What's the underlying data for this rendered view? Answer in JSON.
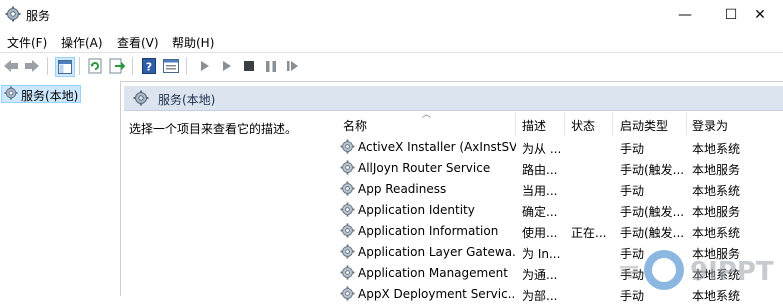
{
  "window": {
    "title": "服务",
    "minimize_glyph": "—",
    "maximize_glyph": "☐",
    "close_glyph": "✕"
  },
  "menu": [
    {
      "label": "文件(F)"
    },
    {
      "label": "操作(A)"
    },
    {
      "label": "查看(V)"
    },
    {
      "label": "帮助(H)"
    }
  ],
  "toolbar": {
    "icons": [
      "back-arrow-icon",
      "forward-arrow-icon",
      "show-hide-tree-icon",
      "refresh-icon",
      "export-list-icon",
      "help-icon",
      "properties-icon",
      "start-service-icon",
      "start-service-params-icon",
      "stop-service-icon",
      "pause-service-icon",
      "resume-service-icon"
    ]
  },
  "tree": {
    "item_label": "服务(本地)"
  },
  "panel": {
    "title": "服务(本地)",
    "description_prompt": "选择一个项目来查看它的描述。"
  },
  "columns": {
    "name": "名称",
    "desc": "描述",
    "status": "状态",
    "startup": "启动类型",
    "logon": "登录为"
  },
  "services": [
    {
      "name": "ActiveX Installer (AxInstSV)",
      "desc": "为从 ...",
      "status": "",
      "startup": "手动",
      "logon": "本地系统"
    },
    {
      "name": "AllJoyn Router Service",
      "desc": "路由...",
      "status": "",
      "startup": "手动(触发...",
      "logon": "本地服务"
    },
    {
      "name": "App Readiness",
      "desc": "当用...",
      "status": "",
      "startup": "手动",
      "logon": "本地系统"
    },
    {
      "name": "Application Identity",
      "desc": "确定...",
      "status": "",
      "startup": "手动(触发...",
      "logon": "本地服务"
    },
    {
      "name": "Application Information",
      "desc": "使用...",
      "status": "正在...",
      "startup": "手动(触发...",
      "logon": "本地系统"
    },
    {
      "name": "Application Layer Gatewa...",
      "desc": "为 In...",
      "status": "",
      "startup": "手动",
      "logon": "本地服务"
    },
    {
      "name": "Application Management",
      "desc": "为通...",
      "status": "",
      "startup": "手动",
      "logon": "本地系统"
    },
    {
      "name": "AppX Deployment Servic...",
      "desc": "为部...",
      "status": "",
      "startup": "手动",
      "logon": "本地系统"
    }
  ],
  "watermark": {
    "text": "9IPPT"
  }
}
